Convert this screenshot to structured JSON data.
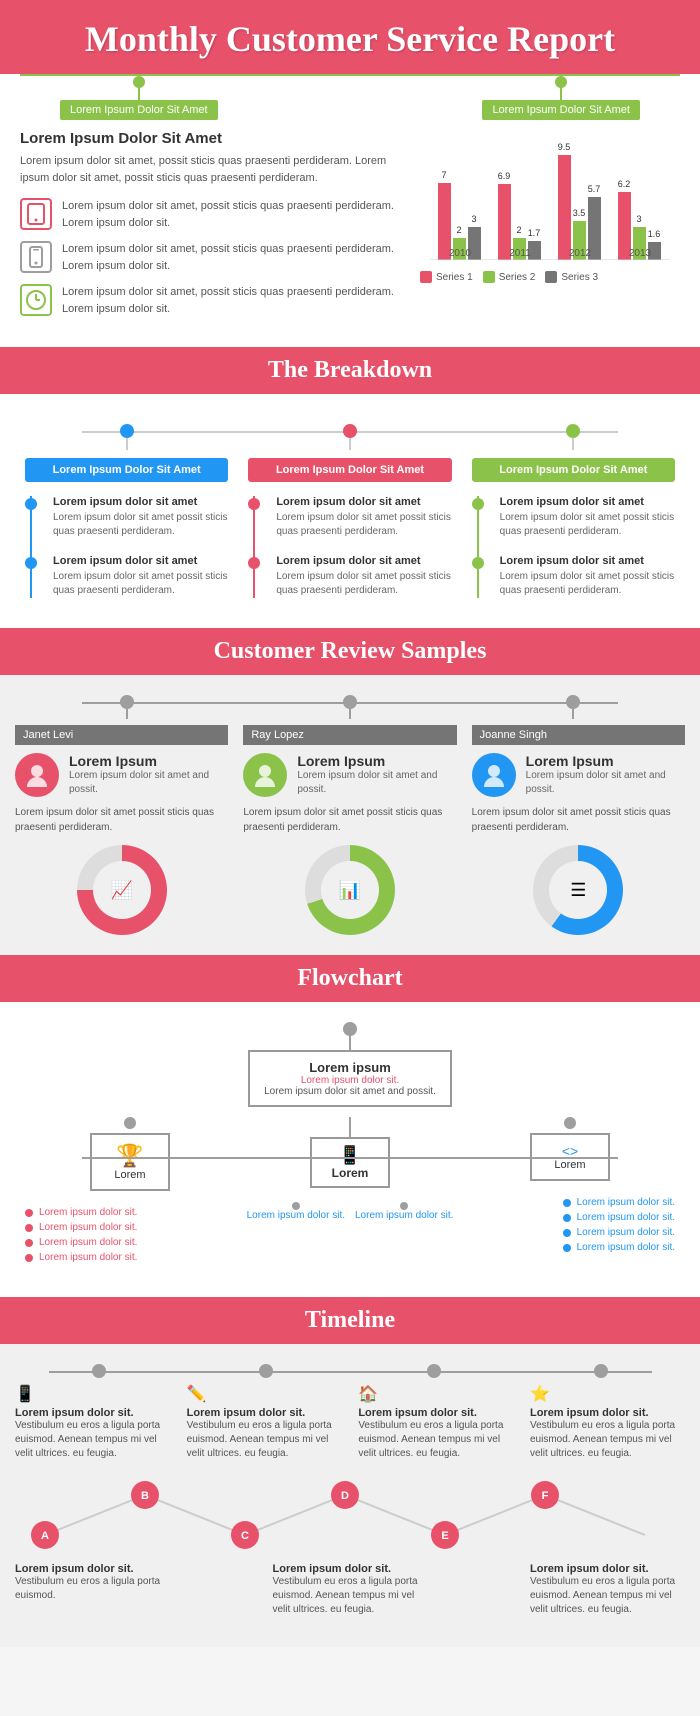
{
  "header": {
    "title": "Monthly Customer Service Report"
  },
  "section1": {
    "tag_left": "Lorem Ipsum Dolor Sit Amet",
    "tag_right": "Lorem Ipsum Dolor Sit Amet",
    "heading": "Lorem Ipsum Dolor Sit Amet",
    "intro": "Lorem ipsum dolor sit amet, possit sticis quas praesenti perdideram. Lorem ipsum dolor sit amet, possit sticis quas praesenti perdideram.",
    "icons": [
      {
        "type": "tablet",
        "text": "Lorem ipsum dolor sit amet, possit sticis quas praesenti perdideram. Lorem ipsum dolor sit."
      },
      {
        "type": "phone",
        "text": "Lorem ipsum dolor sit amet, possit sticis quas praesenti perdideram. Lorem ipsum dolor sit."
      },
      {
        "type": "clock",
        "text": "Lorem ipsum dolor sit amet, possit sticis quas praesenti perdideram. Lorem ipsum dolor sit."
      }
    ],
    "chart": {
      "groups": [
        {
          "year": "2010",
          "s1": 7,
          "s2": 2,
          "s3": 3
        },
        {
          "year": "2011",
          "s1": 6.9,
          "s2": 2,
          "s3": 1.7
        },
        {
          "year": "2012",
          "s1": 9.5,
          "s2": 3.5,
          "s3": 5.7
        },
        {
          "year": "2013",
          "s1": 6.2,
          "s2": 3,
          "s3": 1.6
        }
      ],
      "legend": [
        "Series 1",
        "Series 2",
        "Series 3"
      ],
      "colors": [
        "#e8516a",
        "#8bc34a",
        "#757575"
      ]
    }
  },
  "breakdown": {
    "section_title": "The Breakdown",
    "columns": [
      {
        "color": "blue",
        "title": "Lorem Ipsum Dolor Sit Amet",
        "items": [
          {
            "heading": "Lorem ipsum dolor sit amet",
            "body": "Lorem ipsum dolor sit amet possit sticis quas praesenti perdideram."
          },
          {
            "heading": "Lorem ipsum dolor sit amet",
            "body": "Lorem ipsum dolor sit amet possit sticis quas praesenti perdideram."
          }
        ]
      },
      {
        "color": "pink",
        "title": "Lorem Ipsum Dolor Sit Amet",
        "items": [
          {
            "heading": "Lorem ipsum dolor sit amet",
            "body": "Lorem ipsum dolor sit amet possit sticis quas praesenti perdideram."
          },
          {
            "heading": "Lorem ipsum dolor sit amet",
            "body": "Lorem ipsum dolor sit amet possit sticis quas praesenti perdideram."
          }
        ]
      },
      {
        "color": "olive",
        "title": "Lorem Ipsum Dolor Sit Amet",
        "items": [
          {
            "heading": "Lorem ipsum dolor sit amet",
            "body": "Lorem ipsum dolor sit amet possit sticis quas praesenti perdideram."
          },
          {
            "heading": "Lorem ipsum dolor sit amet",
            "body": "Lorem ipsum dolor sit amet possit sticis quas praesenti perdideram."
          }
        ]
      }
    ]
  },
  "reviews": {
    "section_title": "Customer Review Samples",
    "customers": [
      {
        "name": "Janet Levi",
        "avatar_color": "pink",
        "product": "Lorem Ipsum",
        "desc": "Lorem ipsum dolor sit amet and possit.",
        "review": "Lorem ipsum dolor sit amet possit sticis quas praesenti perdideram.",
        "icon": "📈"
      },
      {
        "name": "Ray Lopez",
        "avatar_color": "olive",
        "product": "Lorem Ipsum",
        "desc": "Lorem ipsum dolor sit amet and possit.",
        "review": "Lorem ipsum dolor sit amet possit sticis quas praesenti perdideram.",
        "icon": "📊"
      },
      {
        "name": "Joanne Singh",
        "avatar_color": "blue",
        "product": "Lorem Ipsum",
        "desc": "Lorem ipsum dolor sit amet and possit.",
        "review": "Lorem ipsum dolor sit amet possit sticis quas praesenti perdideram.",
        "icon": "≡"
      }
    ]
  },
  "flowchart": {
    "section_title": "Flowchart",
    "center_top": {
      "title": "Lorem ipsum",
      "subtitle": "Lorem ipsum dolor sit.",
      "body": "Lorem ipsum dolor sit amet and possit."
    },
    "center_bottom": {
      "label": "Lorem",
      "icon": "📱"
    },
    "left": {
      "icon": "🏆",
      "label": "Lorem",
      "items": [
        "Lorem ipsum dolor sit.",
        "Lorem ipsum dolor sit.",
        "Lorem ipsum dolor sit.",
        "Lorem ipsum dolor sit."
      ]
    },
    "right": {
      "icon": "<>",
      "label": "Lorem",
      "items": [
        "Lorem ipsum dolor sit.",
        "Lorem ipsum dolor sit.",
        "Lorem ipsum dolor sit.",
        "Lorem ipsum dolor sit."
      ]
    },
    "bottom_labels": [
      "Lorem ipsum dolor sit.",
      "Lorem ipsum dolor sit."
    ]
  },
  "timeline": {
    "section_title": "Timeline",
    "nodes": [
      {
        "label": "A",
        "title": "Lorem ipsum dolor sit.",
        "body": "Vestibulum eu eros a ligula porta euismod. Aenean tempus mi vel velit ultrices. eu feugia."
      },
      {
        "label": "B",
        "title": "",
        "body": ""
      },
      {
        "label": "C",
        "title": "Lorem ipsum dolor sit.",
        "body": "Vestibulum eu eros a ligula porta euismod. Aenean tempus mi vel velit ultrices. eu feugia."
      },
      {
        "label": "D",
        "title": "",
        "body": ""
      },
      {
        "label": "E",
        "title": "Lorem ipsum dolor sit.",
        "body": "Vestibulum eu eros a ligula porta euismod. Aenean tempus mi vel velit ultrices. eu feugia."
      },
      {
        "label": "F",
        "title": "",
        "body": ""
      }
    ],
    "top_entries": [
      {
        "icon": "📱",
        "title": "Lorem ipsum dolor sit.",
        "body": "Vestibulum eu eros a ligula porta euismod. Aenean tempus mi vel velit ultrices. eu feugia."
      },
      {
        "icon": "✏️",
        "title": "Lorem ipsum dolor sit.",
        "body": "Vestibulum eu eros a ligula porta euismod. Aenean tempus mi vel velit ultrices. eu feugia."
      },
      {
        "icon": "🏠",
        "title": "Lorem ipsum dolor sit.",
        "body": "Vestibulum eu eros a ligula porta euismod. Aenean tempus mi vel velit ultrices. eu feugia."
      },
      {
        "icon": "⭐",
        "title": "Lorem ipsum dolor sit.",
        "body": "Vestibulum eu eros a ligula porta euismod. Aenean tempus mi vel velit ultrices. eu feugia."
      }
    ],
    "bottom_entries": [
      {
        "title": "Lorem ipsum dolor sit.",
        "body": "Vestibulum eu eros a ligula porta euismod."
      },
      {
        "title": "Lorem ipsum dolor sit.",
        "body": "Vestibulum eu eros a ligula porta euismod. Aenean tempus mi vel velit ultrices. eu feugia."
      },
      {
        "title": "Lorem ipsum dolor sit.",
        "body": "Vestibulum eu eros a ligula porta euismod. Aenean tempus mi vel velit ultrices. eu feugia."
      }
    ]
  }
}
